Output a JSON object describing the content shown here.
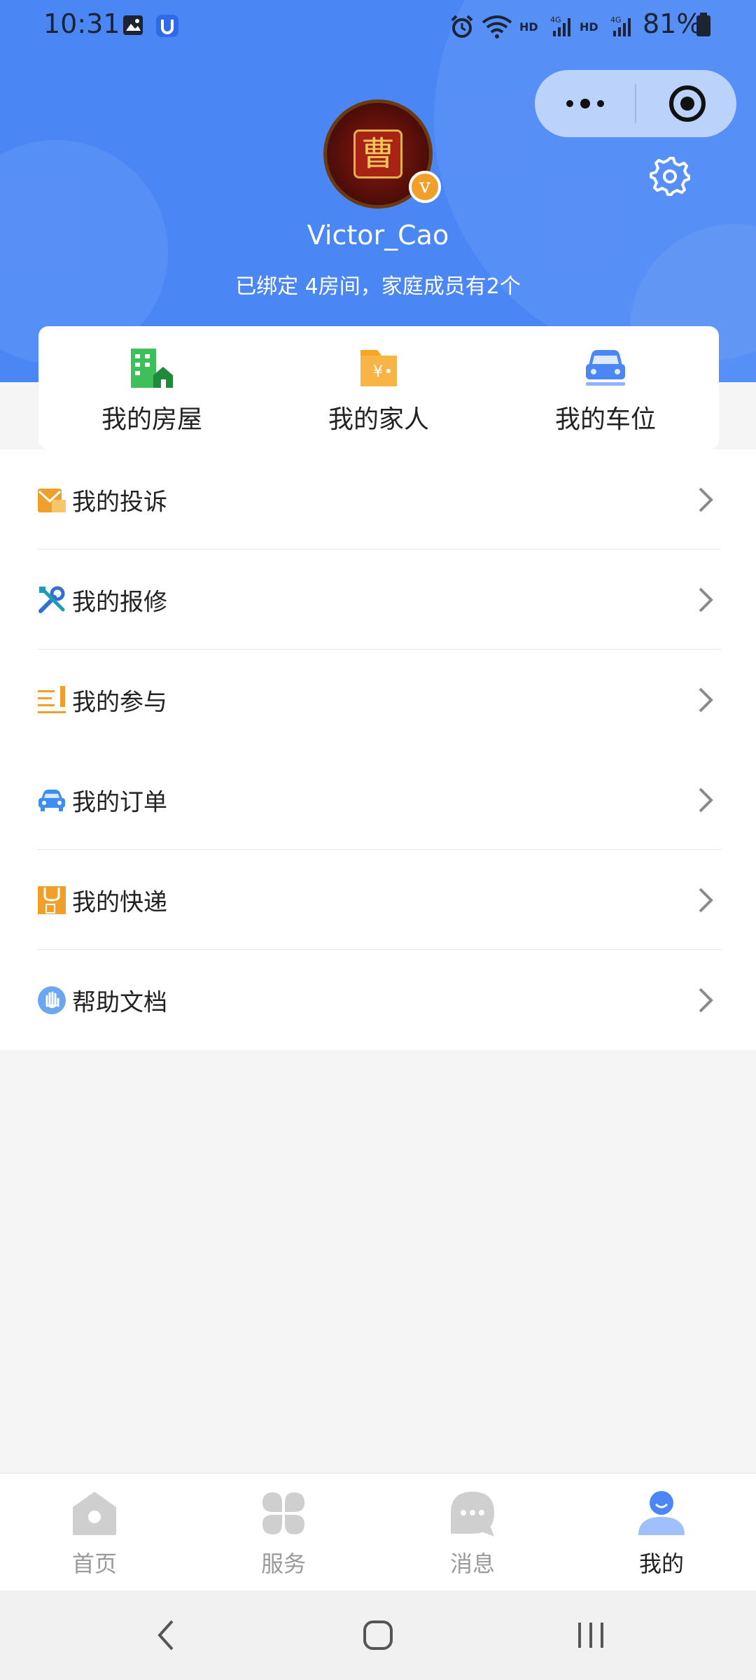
{
  "status_bar": {
    "time": "10:31",
    "battery": "81%",
    "icons": [
      "image-icon",
      "app-notification-icon",
      "alarm-icon",
      "wifi-icon",
      "hd-signal-icon",
      "hd-signal-icon"
    ]
  },
  "header": {
    "username": "Victor_Cao",
    "bound_info": "已绑定 4房间，家庭成员有2个",
    "avatar_badge": "v",
    "avatar_glyph": "曹"
  },
  "quick_actions": [
    {
      "label": "我的房屋",
      "icon": "building-icon"
    },
    {
      "label": "我的家人",
      "icon": "family-folder-icon"
    },
    {
      "label": "我的车位",
      "icon": "car-icon"
    }
  ],
  "menu": [
    {
      "label": "我的投诉",
      "icon": "complaint-envelope-icon"
    },
    {
      "label": "我的报修",
      "icon": "repair-tools-icon"
    },
    {
      "label": "我的参与",
      "icon": "list-icon"
    },
    {
      "label": "我的订单",
      "icon": "car-order-icon"
    },
    {
      "label": "我的快递",
      "icon": "parcel-icon"
    },
    {
      "label": "帮助文档",
      "icon": "help-hand-icon"
    }
  ],
  "tabs": [
    {
      "label": "首页",
      "icon": "home-icon",
      "active": false
    },
    {
      "label": "服务",
      "icon": "services-grid-icon",
      "active": false
    },
    {
      "label": "消息",
      "icon": "message-icon",
      "active": false
    },
    {
      "label": "我的",
      "icon": "profile-icon",
      "active": true
    }
  ],
  "colors": {
    "header_blue": "#4a87f5",
    "badge_orange": "#f0a02a"
  }
}
